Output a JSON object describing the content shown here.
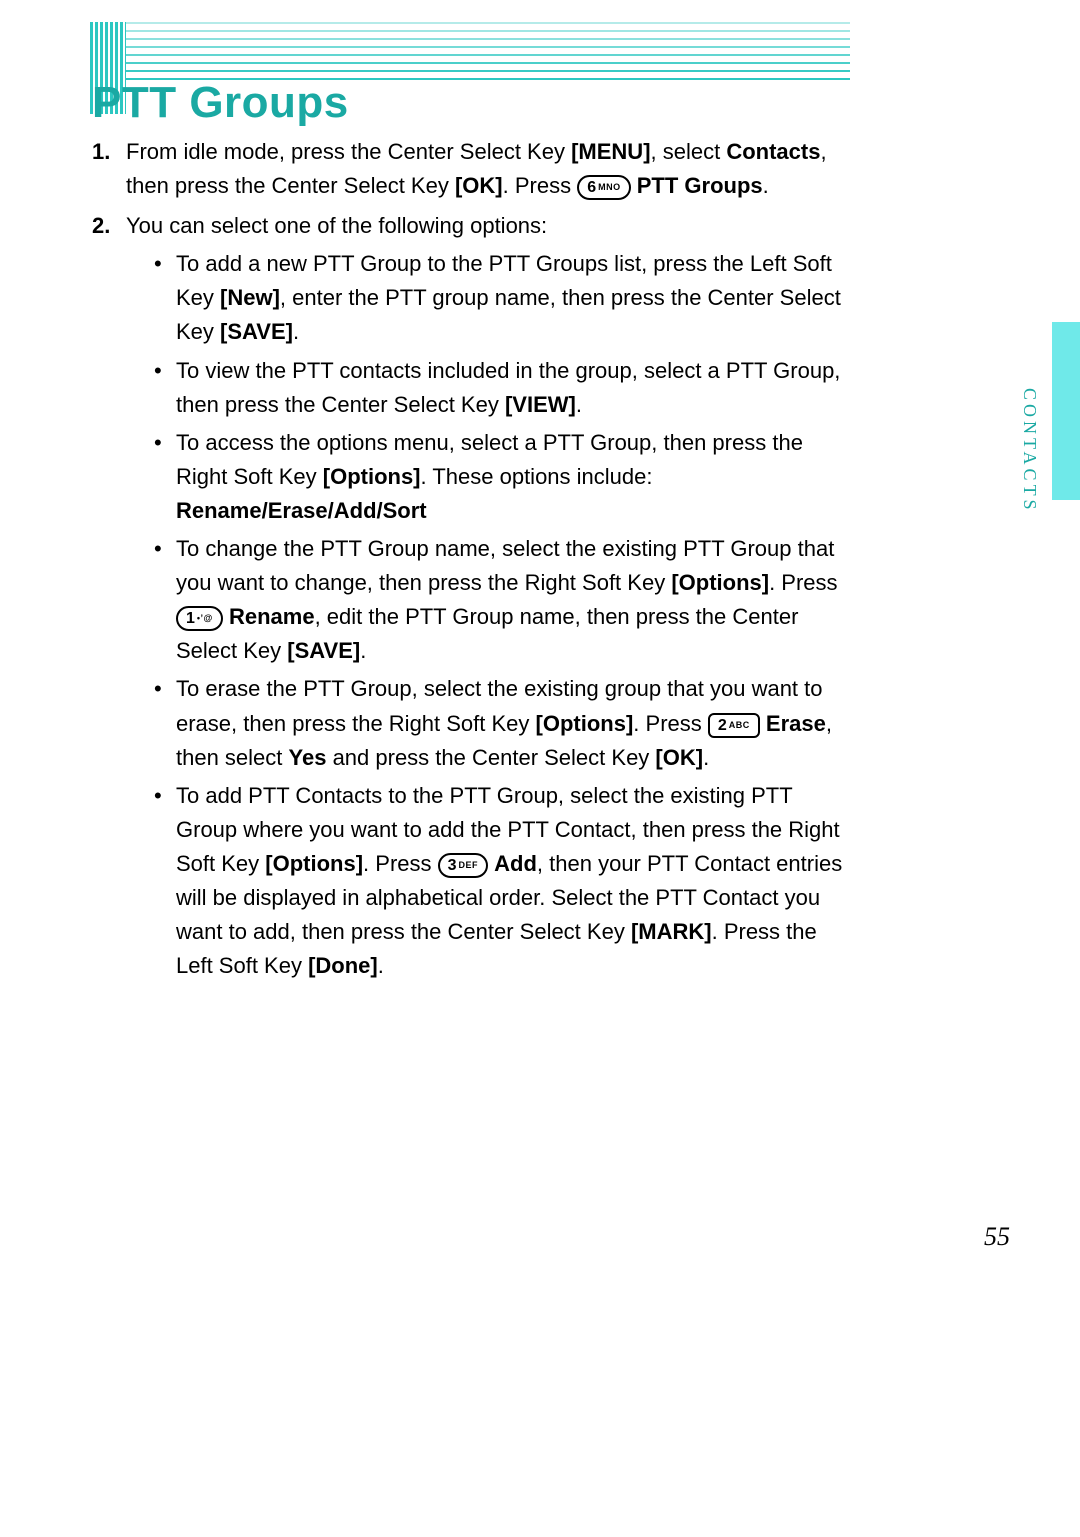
{
  "title": "PTT Groups",
  "side_label": "CONTACTS",
  "page_number": "55",
  "step1": {
    "num": "1.",
    "t1": "From idle mode, press the Center Select Key ",
    "k_menu": "[MENU]",
    "t2": ", select ",
    "k_contacts": "Contacts",
    "t3": ", then press the Center Select Key ",
    "k_ok": "[OK]",
    "t4": ". Press ",
    "key6_num": "6",
    "key6_sub": "MNO",
    "k_ptt_groups": "PTT Groups",
    "t5": "."
  },
  "step2": {
    "num": "2.",
    "lead": "You can select one of the following options:",
    "b1": {
      "t1": "To add a new PTT Group to the PTT Groups list, press the Left Soft Key ",
      "k_new": "[New]",
      "t2": ", enter the PTT group name, then press the Center Select Key ",
      "k_save": "[SAVE]",
      "t3": "."
    },
    "b2": {
      "t1": "To view the PTT contacts included in the group, select a PTT Group, then press the Center Select Key ",
      "k_view": "[VIEW]",
      "t2": "."
    },
    "b3": {
      "t1": "To access the options menu, select a PTT Group, then press the Right Soft Key ",
      "k_options": "[Options]",
      "t2": ". These options include: ",
      "k_list": "Rename/Erase/Add/Sort"
    },
    "b4": {
      "t1": "To change the PTT Group name, select the existing PTT Group that you want to change, then press the Right Soft Key ",
      "k_options": "[Options]",
      "t2": ". Press ",
      "key1_num": "1",
      "key1_sub": "",
      "k_rename": "Rename",
      "t3": ", edit the PTT Group name, then press the Center Select Key ",
      "k_save": "[SAVE]",
      "t4": "."
    },
    "b5": {
      "t1": "To erase the PTT Group, select the existing group that you want to erase, then press the Right Soft Key ",
      "k_options": "[Options]",
      "t2": ". Press ",
      "key2_num": "2",
      "key2_sub": "ABC",
      "k_erase": "Erase",
      "t3": ", then select ",
      "k_yes": "Yes",
      "t4": " and press the Center Select Key ",
      "k_ok": "[OK]",
      "t5": "."
    },
    "b6": {
      "t1": "To add PTT Contacts to the PTT Group, select the existing PTT Group where you want to add the PTT Contact, then press the Right Soft Key ",
      "k_options": "[Options]",
      "t2": ". Press ",
      "key3_num": "3",
      "key3_sub": "DEF",
      "k_add": "Add",
      "t3": ", then your PTT Contact entries will be displayed in alphabetical order. Select the PTT Contact you want to add, then press the Center Select Key ",
      "k_mark": "[MARK]",
      "t4": ". Press the Left Soft Key ",
      "k_done": "[Done]",
      "t5": "."
    }
  }
}
